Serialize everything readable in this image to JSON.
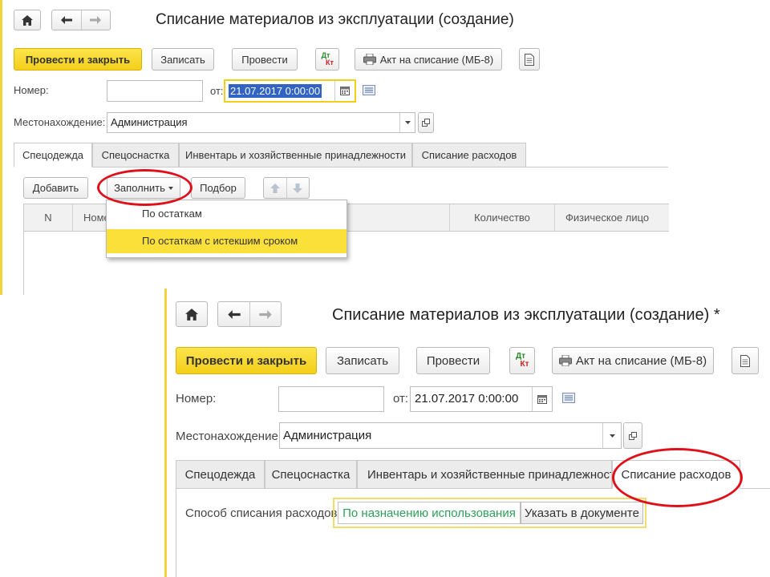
{
  "top": {
    "title": "Списание материалов из эксплуатации (создание)",
    "toolbar": {
      "post_close": "Провести и закрыть",
      "save": "Записать",
      "post": "Провести",
      "dtkt_top": "Дт",
      "dtkt_bottom": "Кт",
      "act": "Акт на списание (МБ-8)"
    },
    "number_label": "Номер:",
    "number_value": "",
    "from_label": "от:",
    "date_value": "21.07.2017  0:00:00",
    "location_label": "Местонахождение:",
    "location_value": "Администрация",
    "tabs": [
      "Спецодежда",
      "Спецоснастка",
      "Инвентарь и хозяйственные принадлежности",
      "Списание расходов"
    ],
    "table_toolbar": {
      "add": "Добавить",
      "fill": "Заполнить",
      "pick": "Подбор"
    },
    "columns": {
      "n": "N",
      "nom": "Номе",
      "qty": "Количество",
      "person": "Физическое лицо"
    },
    "dropdown": [
      "По остаткам",
      "По остаткам с истекшим сроком"
    ]
  },
  "bottom": {
    "title": "Списание материалов из эксплуатации (создание) *",
    "toolbar": {
      "post_close": "Провести и закрыть",
      "save": "Записать",
      "post": "Провести",
      "dtkt_top": "Дт",
      "dtkt_bottom": "Кт",
      "act": "Акт на списание (МБ-8)"
    },
    "number_label": "Номер:",
    "number_value": "",
    "from_label": "от:",
    "date_value": "21.07.2017  0:00:00",
    "location_label": "Местонахождение:",
    "location_value": "Администрация",
    "tabs": [
      "Спецодежда",
      "Спецоснастка",
      "Инвентарь и хозяйственные принадлежности",
      "Списание расходов"
    ],
    "method_label": "Способ списания расходов:",
    "method_options": [
      "По назначению использования",
      "Указать в документе"
    ]
  },
  "colors": {
    "accent_yellow": "#f3cf1a",
    "highlight_red": "#e0101a",
    "selected_green": "#2e9e5a",
    "selection_blue": "#3163c5"
  }
}
